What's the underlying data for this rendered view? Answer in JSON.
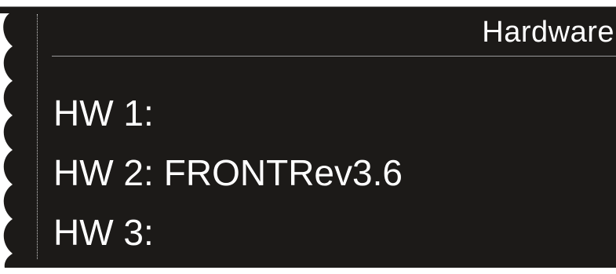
{
  "panel": {
    "title": "Hardware",
    "background_color": "#1c1a18",
    "text_color": "#ffffff"
  },
  "hardware": [
    {
      "label": "HW 1:",
      "value": ""
    },
    {
      "label": "HW 2:",
      "value": "FRONTRev3.6"
    },
    {
      "label": "HW 3:",
      "value": ""
    }
  ]
}
